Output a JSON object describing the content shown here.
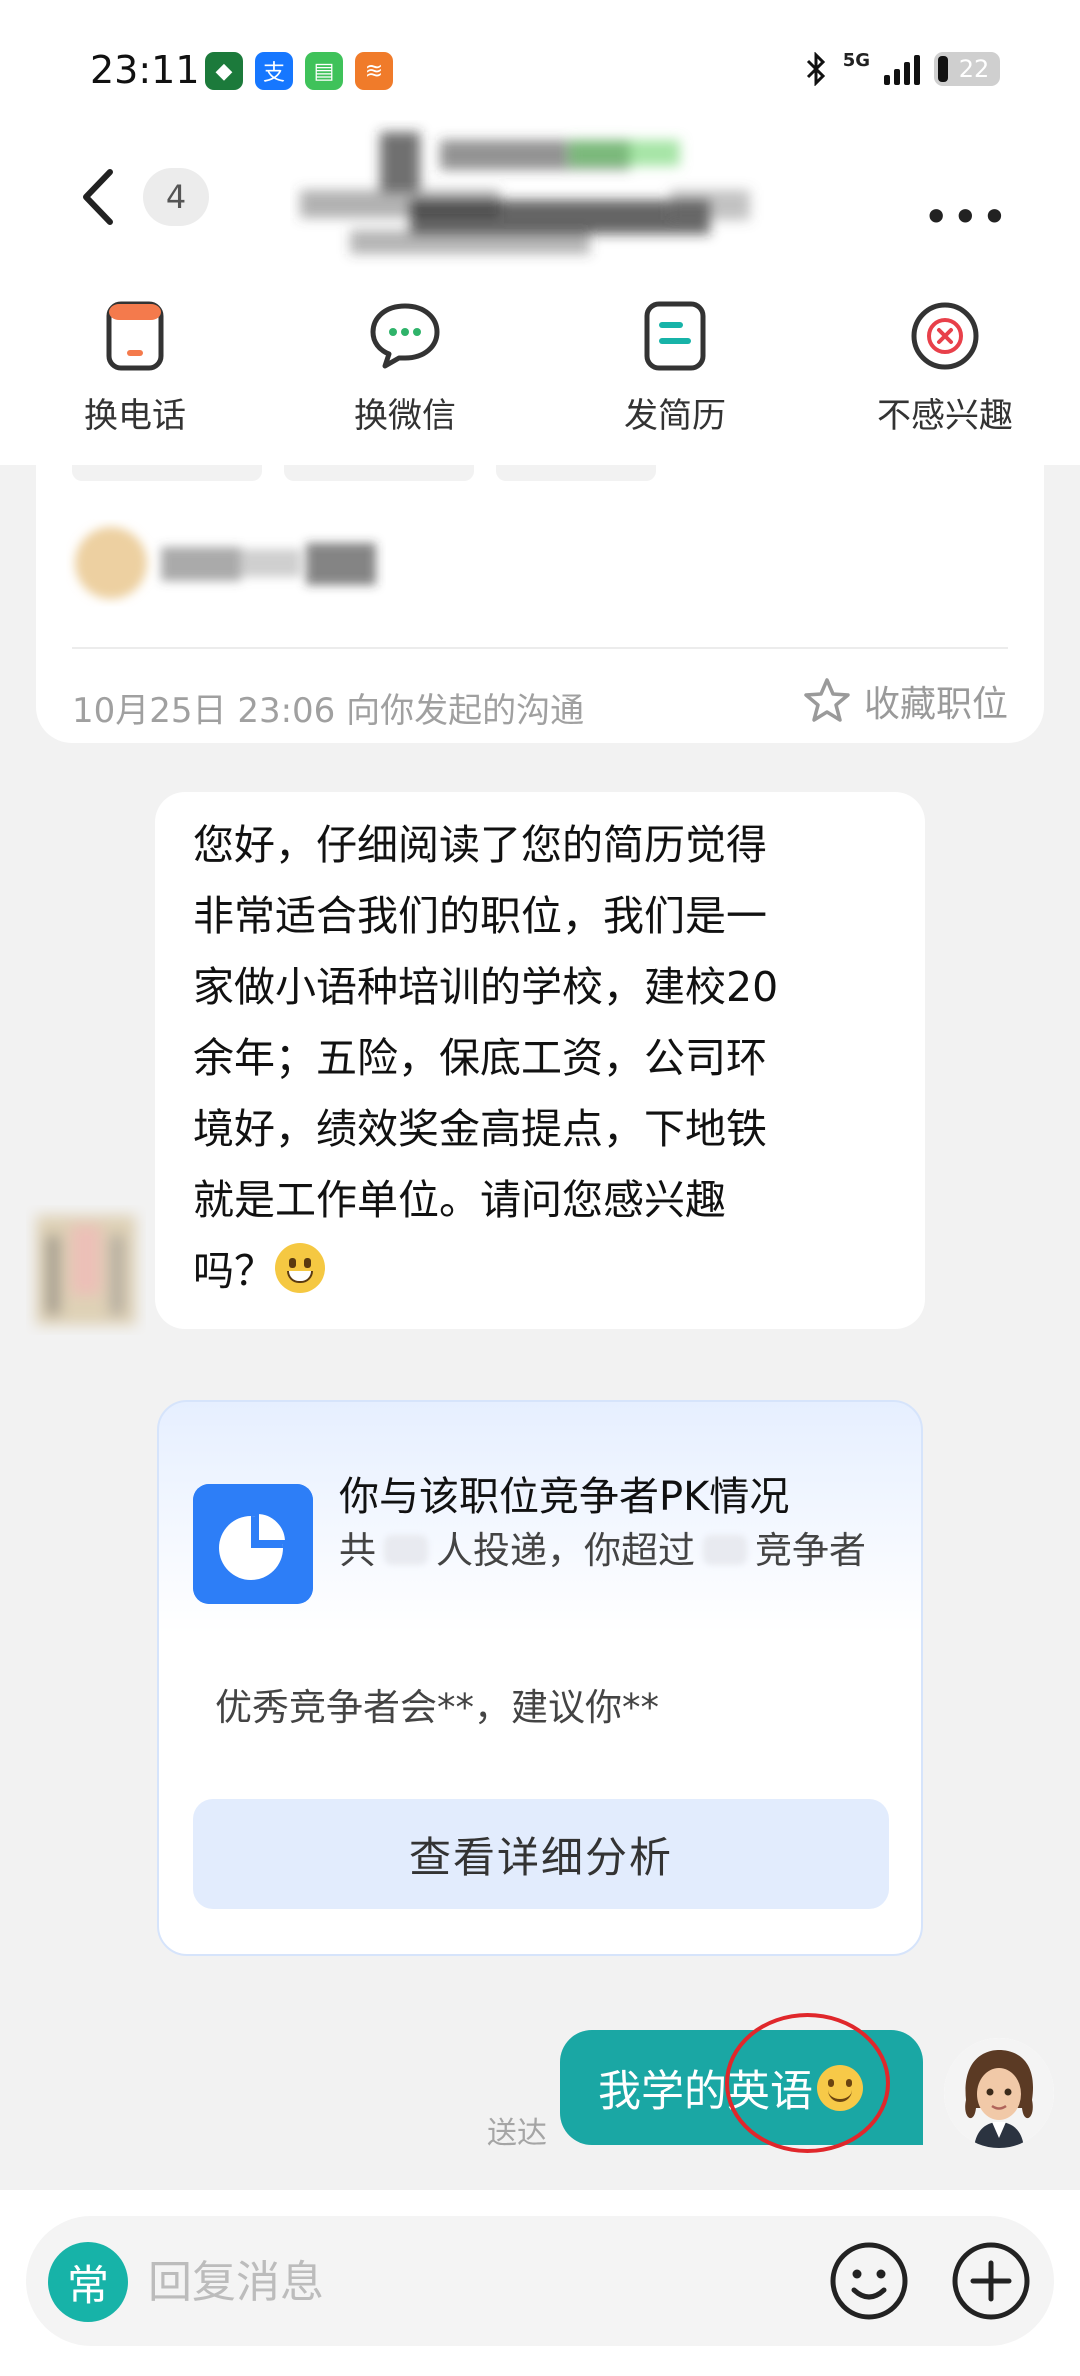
{
  "status_bar": {
    "time": "23:11",
    "network": "5G",
    "battery": "22",
    "apps": [
      {
        "name": "box-app-icon",
        "color": "#1c7a3b",
        "glyph": "◆"
      },
      {
        "name": "alipay-app-icon",
        "color": "#1677ff",
        "glyph": "支"
      },
      {
        "name": "messages-app-icon",
        "color": "#3fc25a",
        "glyph": "▤"
      },
      {
        "name": "stripe-app-icon",
        "color": "#f07b2a",
        "glyph": "≋"
      }
    ]
  },
  "header": {
    "unread_count": "4"
  },
  "actions": [
    {
      "label": "换电话",
      "icon": "phone-icon"
    },
    {
      "label": "换微信",
      "icon": "wechat-icon"
    },
    {
      "label": "发简历",
      "icon": "resume-icon"
    },
    {
      "label": "不感兴趣",
      "icon": "not-interested-icon"
    }
  ],
  "job_card": {
    "initiated_text": "10月25日 23:06 向你发起的沟通",
    "favorite_label": "收藏职位"
  },
  "incoming_message": {
    "lines": [
      "您好，仔细阅读了您的简历觉得",
      "非常适合我们的职位，我们是一",
      "家做小语种培训的学校，建校20",
      "余年；五险，保底工资，公司环",
      "境好，绩效奖金高提点，下地铁",
      "就是工作单位。请问您感兴趣"
    ],
    "last_line": "吗？"
  },
  "pk_card": {
    "title": "你与该职位竞争者PK情况",
    "sub_prefix": "共",
    "sub_middle": "人投递，你超过",
    "sub_suffix": "竞争者",
    "advice": "优秀竞争者会**，建议你**",
    "button_label": "查看详细分析"
  },
  "outgoing_message": {
    "text": "我学的英语",
    "status": "送达"
  },
  "input_bar": {
    "quick_label": "常",
    "placeholder": "回复消息"
  },
  "colors": {
    "accent_teal": "#1aa7a4",
    "pk_blue": "#2d7ef7",
    "annotation_red": "#e0272b"
  }
}
